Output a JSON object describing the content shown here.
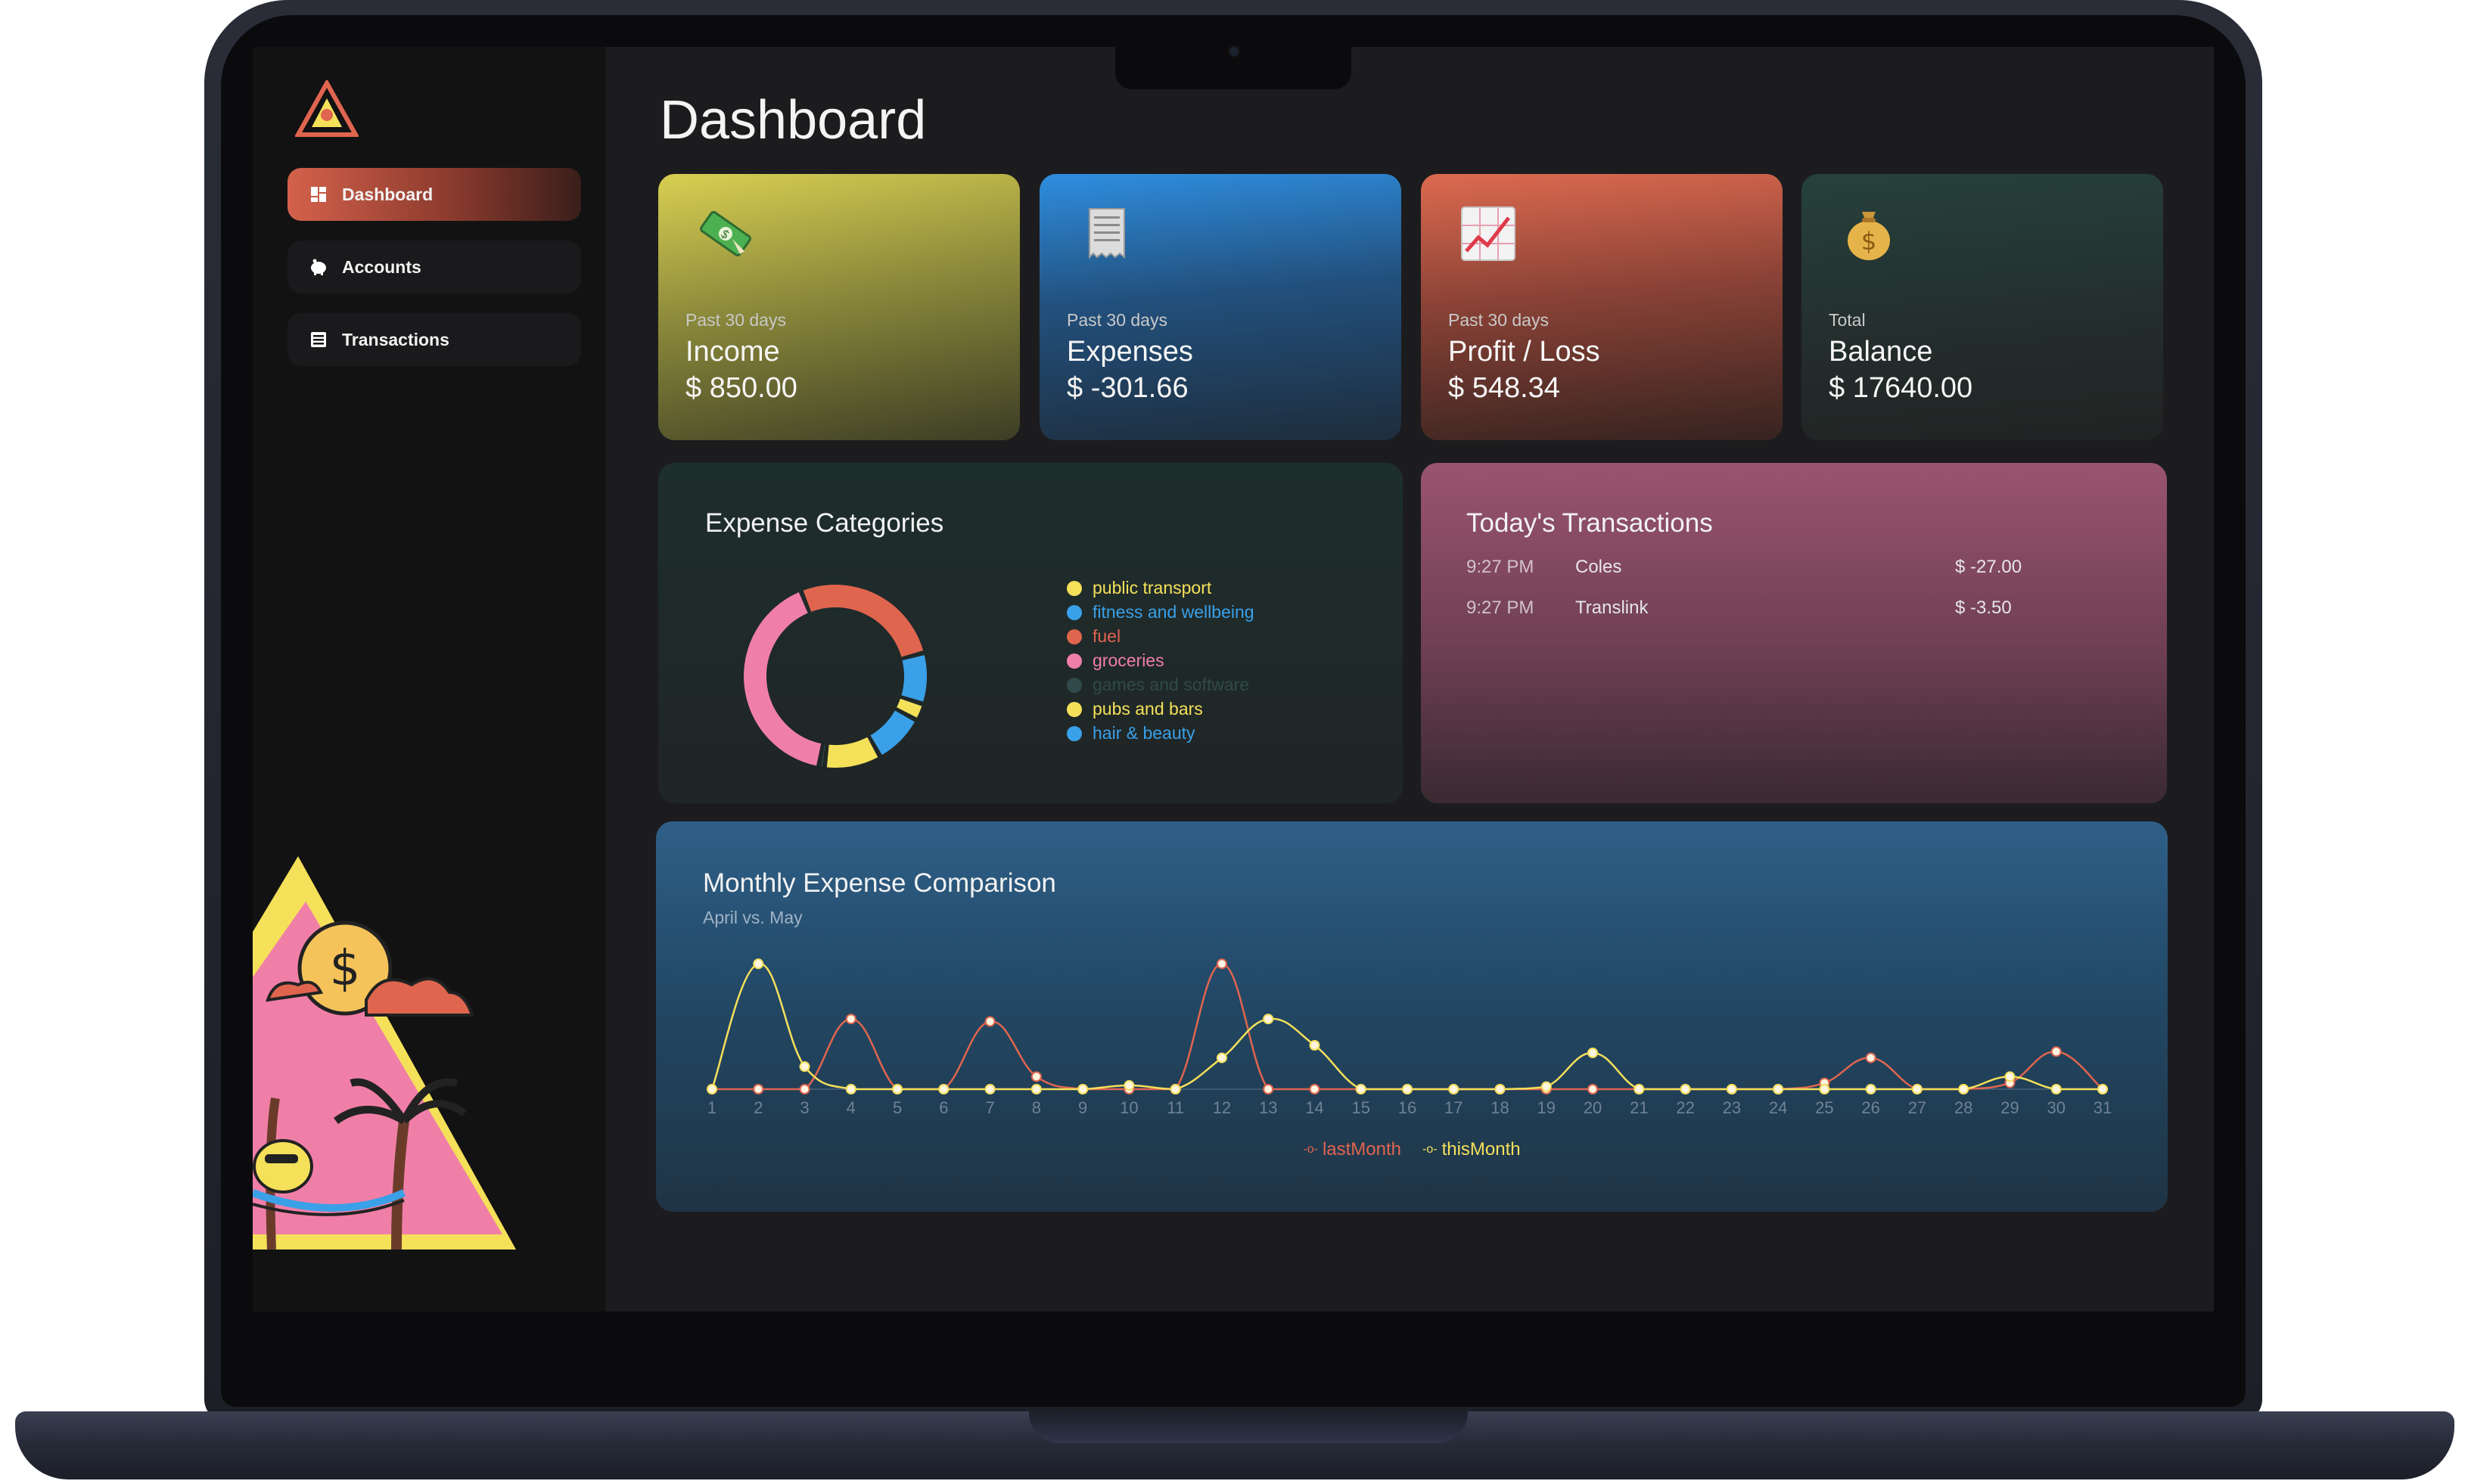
{
  "app": {
    "page_title": "Dashboard"
  },
  "sidebar": {
    "items": [
      {
        "label": "Dashboard",
        "icon": "grid-icon",
        "active": true
      },
      {
        "label": "Accounts",
        "icon": "piggy-bank-icon",
        "active": false
      },
      {
        "label": "Transactions",
        "icon": "list-icon",
        "active": false
      }
    ]
  },
  "stats": {
    "income": {
      "sub": "Past 30 days",
      "label": "Income",
      "value": "$ 850.00",
      "icon": "money-icon"
    },
    "expenses": {
      "sub": "Past 30 days",
      "label": "Expenses",
      "value": "$ -301.66",
      "icon": "receipt-icon"
    },
    "profit": {
      "sub": "Past 30 days",
      "label": "Profit / Loss",
      "value": "$ 548.34",
      "icon": "chart-up-icon"
    },
    "balance": {
      "sub": "Total",
      "label": "Balance",
      "value": "$ 17640.00",
      "icon": "money-bag-icon"
    }
  },
  "expense_categories": {
    "title": "Expense Categories",
    "legend": [
      {
        "label": "public transport",
        "color": "#f5e05a"
      },
      {
        "label": "fitness and wellbeing",
        "color": "#3aa0e8"
      },
      {
        "label": "fuel",
        "color": "#e0654f"
      },
      {
        "label": "groceries",
        "color": "#f07fa8"
      },
      {
        "label": "games and software",
        "color": "#2f4a48"
      },
      {
        "label": "pubs and bars",
        "color": "#f5e05a"
      },
      {
        "label": "hair & beauty",
        "color": "#3aa0e8"
      }
    ]
  },
  "todays_transactions": {
    "title": "Today's Transactions",
    "rows": [
      {
        "time": "9:27 PM",
        "merchant": "Coles",
        "amount": "$ -27.00"
      },
      {
        "time": "9:27 PM",
        "merchant": "Translink",
        "amount": "$ -3.50"
      }
    ]
  },
  "monthly_comparison": {
    "title": "Monthly Expense Comparison",
    "subtitle": "April vs. May"
  },
  "chart_data": [
    {
      "type": "pie",
      "title": "Expense Categories",
      "categories": [
        "fuel",
        "fitness and wellbeing",
        "public transport",
        "hair & beauty",
        "pubs and bars",
        "games and software",
        "groceries"
      ],
      "values": [
        27,
        9,
        3,
        9,
        10,
        1,
        41
      ],
      "colors": [
        "#e0654f",
        "#3aa0e8",
        "#f5e05a",
        "#3aa0e8",
        "#f5e05a",
        "#2f4a48",
        "#f07fa8"
      ],
      "donut": true
    },
    {
      "type": "line",
      "title": "Monthly Expense Comparison",
      "subtitle": "April vs. May",
      "x": [
        1,
        2,
        3,
        4,
        5,
        6,
        7,
        8,
        9,
        10,
        11,
        12,
        13,
        14,
        15,
        16,
        17,
        18,
        19,
        20,
        21,
        22,
        23,
        24,
        25,
        26,
        27,
        28,
        29,
        30,
        31
      ],
      "series": [
        {
          "name": "lastMonth",
          "color": "#e0654f",
          "values": [
            0,
            0,
            0,
            56,
            0,
            0,
            54,
            10,
            0,
            0,
            0,
            100,
            0,
            0,
            0,
            0,
            0,
            0,
            0,
            0,
            0,
            0,
            0,
            0,
            5,
            25,
            0,
            0,
            5,
            30,
            0
          ]
        },
        {
          "name": "thisMonth",
          "color": "#f5e05a",
          "values": [
            0,
            100,
            18,
            0,
            0,
            0,
            0,
            0,
            0,
            3,
            0,
            25,
            56,
            35,
            0,
            0,
            0,
            0,
            2,
            29,
            0,
            0,
            0,
            0,
            0,
            0,
            0,
            0,
            10,
            0,
            0
          ]
        }
      ],
      "ylim": [
        0,
        105
      ],
      "grid": false,
      "legend": "bottom"
    }
  ]
}
